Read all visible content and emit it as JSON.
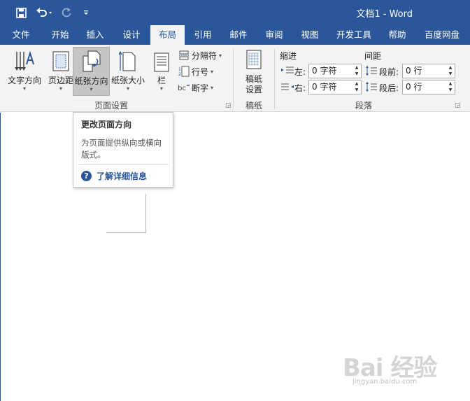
{
  "window": {
    "title": "文档1 - Word"
  },
  "quick_access": {
    "save_icon": "save-icon",
    "undo_icon": "undo-icon",
    "redo_icon": "redo-icon",
    "customize_icon": "customize-qat-icon"
  },
  "tabs": [
    {
      "label": "文件"
    },
    {
      "label": "开始"
    },
    {
      "label": "插入"
    },
    {
      "label": "设计"
    },
    {
      "label": "布局"
    },
    {
      "label": "引用"
    },
    {
      "label": "邮件"
    },
    {
      "label": "审阅"
    },
    {
      "label": "视图"
    },
    {
      "label": "开发工具"
    },
    {
      "label": "帮助"
    },
    {
      "label": "百度网盘"
    }
  ],
  "ribbon": {
    "page_setup": {
      "group_label": "页面设置",
      "text_direction": "文字方向",
      "margins": "页边距",
      "orientation": "纸张方向",
      "size": "纸张大小",
      "columns": "栏",
      "breaks": "分隔符",
      "line_numbers": "行号",
      "hyphenation": "断字"
    },
    "manuscript": {
      "group_label": "稿纸",
      "button": "稿纸\n设置",
      "button_line1": "稿纸",
      "button_line2": "设置"
    },
    "paragraph": {
      "group_label": "段落",
      "indent_header": "缩进",
      "spacing_header": "间距",
      "left_label": "左:",
      "right_label": "右:",
      "before_label": "段前:",
      "after_label": "段后:",
      "left_value": "0 字符",
      "right_value": "0 字符",
      "before_value": "0 行",
      "after_value": "0 行"
    }
  },
  "tooltip": {
    "title": "更改页面方向",
    "description": "为页面提供纵向或横向版式。",
    "help_link": "了解详细信息"
  },
  "watermark": {
    "main": "Bai 经验",
    "sub": "jingyan.baidu.com"
  },
  "colors": {
    "accent": "#2b579a",
    "ribbon_bg": "#f3f3f3"
  }
}
